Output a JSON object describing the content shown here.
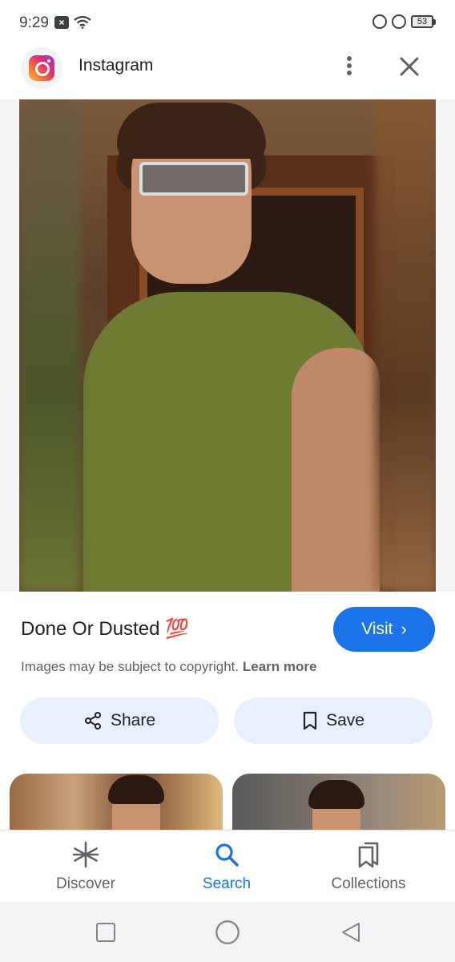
{
  "status_bar": {
    "time": "9:29",
    "battery_level": "53"
  },
  "app_header": {
    "app_name": "Instagram",
    "icons": [
      "instagram-logo",
      "more-vert-icon",
      "close-icon"
    ]
  },
  "result": {
    "title": "Done Or Dusted",
    "title_emoji": "💯",
    "visit_label": "Visit",
    "copyright_text": "Images may be subject to copyright.",
    "learn_more_label": "Learn more"
  },
  "actions": {
    "share_label": "Share",
    "save_label": "Save"
  },
  "bottom_nav": {
    "items": [
      {
        "label": "Discover",
        "icon": "asterisk-icon",
        "active": false
      },
      {
        "label": "Search",
        "icon": "search-icon",
        "active": true
      },
      {
        "label": "Collections",
        "icon": "collections-icon",
        "active": false
      }
    ]
  },
  "colors": {
    "accent": "#1a73e8",
    "button_tint": "#e8f0fe",
    "text_primary": "#202124",
    "text_secondary": "#5f6368"
  }
}
